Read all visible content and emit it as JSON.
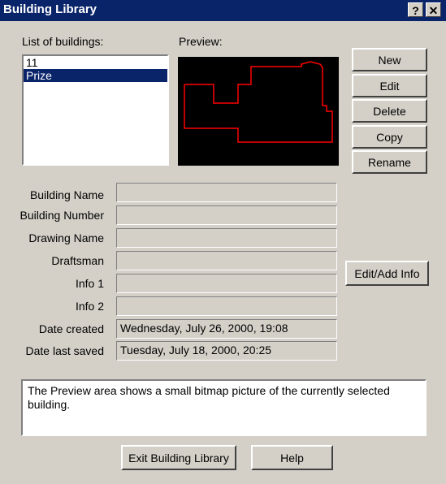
{
  "window": {
    "title": "Building Library",
    "help_glyph": "?",
    "close_glyph": "✕"
  },
  "list": {
    "label": "List of buildings:",
    "items": [
      {
        "label": "11",
        "selected": false
      },
      {
        "label": "Prize",
        "selected": true
      }
    ]
  },
  "preview": {
    "label": "Preview:"
  },
  "buttons": {
    "new": "New",
    "edit": "Edit",
    "delete": "Delete",
    "copy": "Copy",
    "rename": "Rename",
    "edit_add_info": "Edit/Add Info",
    "exit": "Exit Building Library",
    "help": "Help"
  },
  "fields": {
    "building_name": {
      "label": "Building Name",
      "value": ""
    },
    "building_number": {
      "label": "Building Number",
      "value": ""
    },
    "drawing_name": {
      "label": "Drawing Name",
      "value": ""
    },
    "draftsman": {
      "label": "Draftsman",
      "value": ""
    },
    "info1": {
      "label": "Info 1",
      "value": ""
    },
    "info2": {
      "label": "Info 2",
      "value": ""
    },
    "date_created": {
      "label": "Date created",
      "value": "Wednesday, July 26, 2000, 19:08"
    },
    "date_saved": {
      "label": "Date last saved",
      "value": "Tuesday, July 18, 2000, 20:25"
    }
  },
  "hint": "The Preview area shows a small bitmap picture of the currently selected building.",
  "colors": {
    "titlebar": "#0a246a",
    "face": "#d4d0c8",
    "selection": "#0a246a",
    "outline": "#ff0000"
  }
}
